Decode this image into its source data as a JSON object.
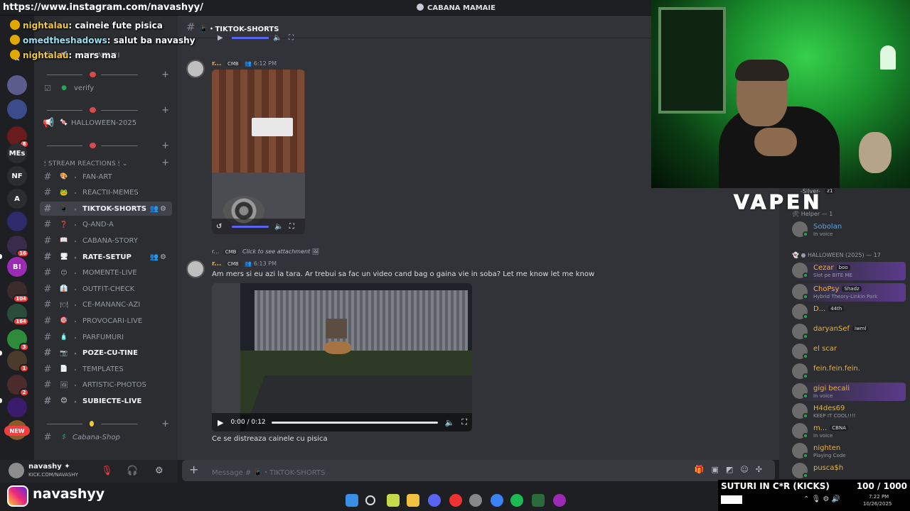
{
  "window": {
    "url_overlay": "https://www.instagram.com/navashyy/",
    "server_title": "CABANA MAMAIE"
  },
  "chat_overlay": [
    {
      "nick": "nightalau",
      "text": "caineie fute pisica"
    },
    {
      "nick": "omedtheshadows",
      "text": "salut ba navashy"
    },
    {
      "nick": "nightalau",
      "text": "mars ma"
    }
  ],
  "server_rail": {
    "items": [
      {
        "label": "k",
        "color": "#1e1f22"
      },
      {
        "label": "",
        "color": "#5b5b8c"
      },
      {
        "label": "",
        "color": "#3b4b8c"
      },
      {
        "label": "",
        "color": "#6a1b1b",
        "badge": "8"
      },
      {
        "label": "MEs",
        "color": "#2b2d31"
      },
      {
        "label": "NF",
        "color": "#2b2d31"
      },
      {
        "label": "A",
        "color": "#2b2d31"
      },
      {
        "label": "",
        "color": "#2e2a6b"
      },
      {
        "label": "",
        "color": "#3b2b4b",
        "badge": "16"
      },
      {
        "label": "B!",
        "color": "#9b2bb5"
      },
      {
        "label": "",
        "color": "#3b2b2b",
        "badge": "104"
      },
      {
        "label": "",
        "color": "#2b4b3b",
        "badge": "164"
      },
      {
        "label": "",
        "color": "#2e8b3a",
        "badge": "3"
      },
      {
        "label": "",
        "color": "#4b3b2b",
        "badge": "1"
      },
      {
        "label": "",
        "color": "#4b2b2b",
        "badge": "2"
      },
      {
        "label": "",
        "color": "#3b1b6b"
      },
      {
        "label": "",
        "color": "#8b5b2b"
      }
    ],
    "new_label": "NEW"
  },
  "sidebar": {
    "announce_label": "ANUNTURI",
    "verify": "verify",
    "halloween": "HALLOWEEN-2025",
    "category": "STREAM REACTIONS",
    "channels": [
      {
        "name": "FAN-ART",
        "emoji": "🎨",
        "state": "normal"
      },
      {
        "name": "REACTII-MEMES",
        "emoji": "🐸",
        "state": "normal"
      },
      {
        "name": "TIKTOK-SHORTS",
        "emoji": "📱",
        "state": "active"
      },
      {
        "name": "Q-AND-A",
        "emoji": "❓",
        "state": "normal"
      },
      {
        "name": "CABANA-STORY",
        "emoji": "📖",
        "state": "normal"
      },
      {
        "name": "RATE-SETUP",
        "emoji": "🖥",
        "state": "unread"
      },
      {
        "name": "MOMENTE-LIVE",
        "emoji": "😊",
        "state": "normal"
      },
      {
        "name": "OUTFIT-CHECK",
        "emoji": "👔",
        "state": "normal"
      },
      {
        "name": "CE-MANANC-AZI",
        "emoji": "🍽",
        "state": "normal"
      },
      {
        "name": "PROVOCARI-LIVE",
        "emoji": "🎯",
        "state": "normal"
      },
      {
        "name": "PARFUMURI",
        "emoji": "🧴",
        "state": "normal"
      },
      {
        "name": "POZE-CU-TINE",
        "emoji": "📷",
        "state": "unread"
      },
      {
        "name": "TEMPLATES",
        "emoji": "📄",
        "state": "normal"
      },
      {
        "name": "ARTISTIC-PHOTOS",
        "emoji": "🖼",
        "state": "normal"
      },
      {
        "name": "SUBIECTE-LIVE",
        "emoji": "😊",
        "state": "unread"
      }
    ],
    "shop": "Cabana-Shop"
  },
  "user_panel": {
    "name": "navashy ✦",
    "sub": "KICK.COM/NAVASHY"
  },
  "social": {
    "handle": "navashyy"
  },
  "chat": {
    "channel": "TIKTOK-SHORTS",
    "messages": [
      {
        "author": "r...",
        "tag": "CMB",
        "time": "6:12 PM"
      },
      {
        "reply_author": "r...",
        "reply_tag": "CMB",
        "reply_text": "Click to see attachment",
        "author": "r...",
        "tag": "CMB",
        "time": "6:13 PM",
        "text": "Am mers si eu azi la tara. Ar trebui sa fac un video cand bag o gaina vie in soba? Let me know let me know"
      }
    ],
    "video2_time": "0:00 / 0:12",
    "caption": "Ce se distreaza cainele cu pisica",
    "composer_placeholder": "Message # 📱・TIKTOK-SHORTS"
  },
  "overlay_brand": "VAPEN",
  "members": {
    "top_partial": "-Silver-",
    "helper_header": "Helper — 1",
    "halloween_header": "HALLOWEEN (2025) — 17",
    "list": [
      {
        "name": "Sobolan",
        "sub": "In voice",
        "color": "#4da6ff",
        "tag": ""
      },
      {
        "name": "Cezar",
        "sub": "Slot pe BITE ME",
        "color": "#f0b232",
        "tag": "boo",
        "hl": true
      },
      {
        "name": "ChoPsy",
        "sub": "Hybrid Theory-Linkin Park",
        "color": "#f0b232",
        "tag": "Shadz",
        "hl": true
      },
      {
        "name": "D...",
        "sub": "",
        "color": "#f0b232",
        "tag": "44th"
      },
      {
        "name": "daryanSef",
        "sub": "",
        "color": "#f0b232",
        "tag": "iwml"
      },
      {
        "name": "el scar",
        "sub": "",
        "color": "#f0b232",
        "tag": ""
      },
      {
        "name": "fein.fein.fein.",
        "sub": "",
        "color": "#f0b232",
        "tag": ""
      },
      {
        "name": "gigi becali",
        "sub": "In voice",
        "color": "#f0b232",
        "tag": "",
        "hl": true
      },
      {
        "name": "H4des69",
        "sub": "KEEP IT COOL!!!!",
        "color": "#f0b232",
        "tag": ""
      },
      {
        "name": "m...",
        "sub": "In voice",
        "color": "#f0b232",
        "tag": "CBNA"
      },
      {
        "name": "nighten",
        "sub": "Playing Code",
        "color": "#f0b232",
        "tag": ""
      },
      {
        "name": "pusca$h",
        "sub": "",
        "color": "#f0b232",
        "tag": ""
      }
    ]
  },
  "subgoal": {
    "label": "SUTURI IN C*R (KICKS)",
    "count": "100 / 1000"
  },
  "tray": {
    "time": "7:22 PM",
    "date": "10/26/2025"
  }
}
